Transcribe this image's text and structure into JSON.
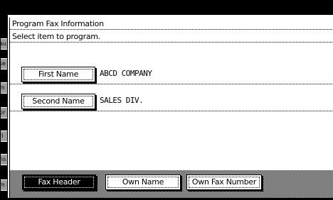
{
  "window": {
    "title": "Program Fax Information",
    "instruction": "Select item to program."
  },
  "fields": [
    {
      "label": "First Name",
      "value": "ABCD COMPANY"
    },
    {
      "label": "Second Name",
      "value": "SALES DIV."
    }
  ],
  "tabs": [
    {
      "label": "Fax Header",
      "active": true
    },
    {
      "label": "Own Name",
      "active": false
    },
    {
      "label": "Own Fax Number",
      "active": false
    }
  ],
  "side_tabs": [
    "au",
    "se",
    "m",
    "pr",
    "ri",
    "ns",
    "m"
  ],
  "colors": {
    "background": "#ffffff",
    "foreground": "#000000",
    "side_tab": "#9a9a9a"
  }
}
